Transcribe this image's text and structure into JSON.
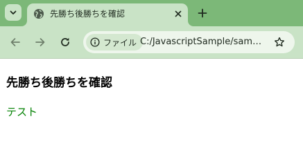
{
  "browser": {
    "tab": {
      "title": "先勝ち後勝ちを確認"
    },
    "omnibox": {
      "security_chip_label": "ファイル",
      "url": "C:/JavascriptSample/sampl..."
    },
    "icons": {
      "tab_search": "chevron-down-icon",
      "favicon": "globe-icon",
      "close": "close-icon",
      "new_tab": "plus-icon",
      "back": "arrow-left-icon",
      "forward": "arrow-right-icon",
      "reload": "reload-icon",
      "info": "info-icon",
      "bookmark": "star-icon"
    },
    "colors": {
      "tab_strip": "#7cb878",
      "active_tab": "#c9e3c6",
      "toolbar": "#c9e3c6",
      "omnibox": "#eef6ec"
    }
  },
  "page": {
    "heading": "先勝ち後勝ちを確認",
    "text": "テスト",
    "text_color": "#008000"
  }
}
